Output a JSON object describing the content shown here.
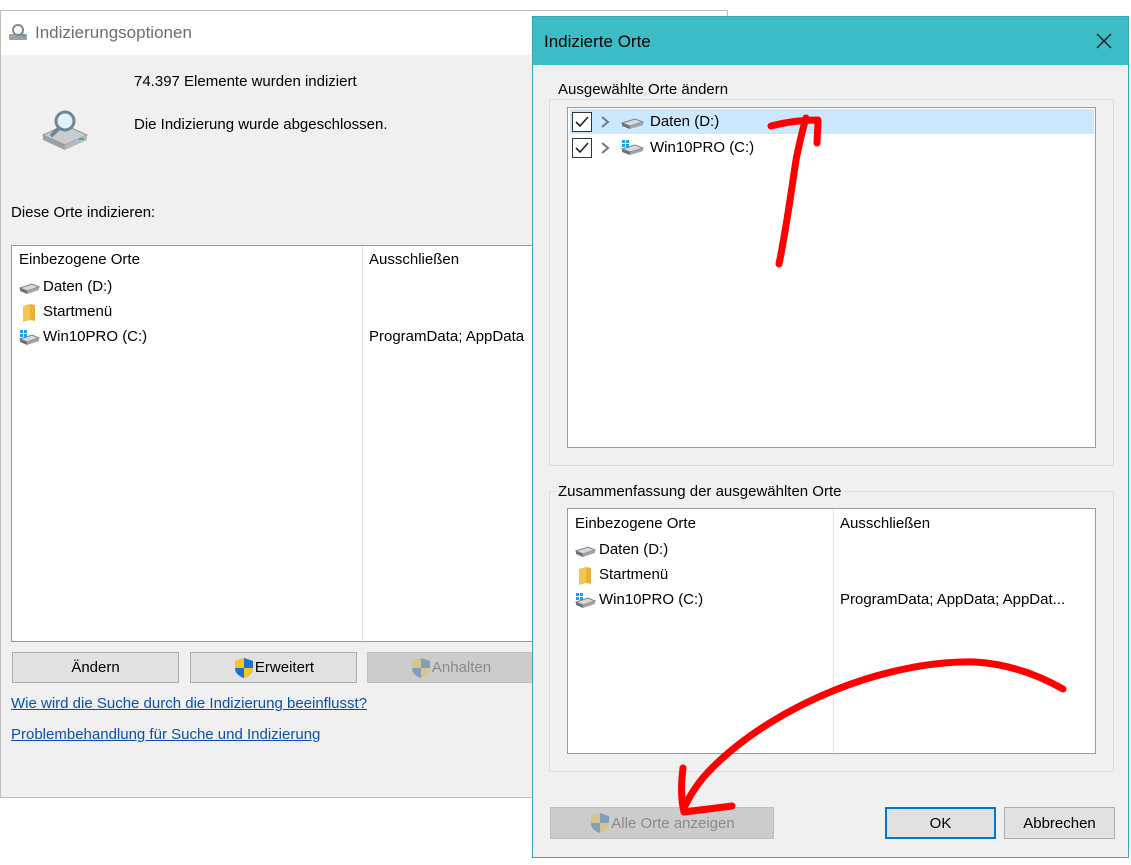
{
  "back_window": {
    "title": "Indizierungsoptionen",
    "status_count": "74.397 Elemente wurden indiziert",
    "status_message": "Die Indizierung wurde abgeschlossen.",
    "section_label": "Diese Orte indizieren:",
    "table": {
      "col_included": "Einbezogene Orte",
      "col_exclude": "Ausschließen",
      "rows": [
        {
          "name": "Daten (D:)",
          "icon": "drive-icon",
          "exclude": ""
        },
        {
          "name": "Startmenü",
          "icon": "folder-icon",
          "exclude": ""
        },
        {
          "name": "Win10PRO (C:)",
          "icon": "windows-drive-icon",
          "exclude": "ProgramData; AppData"
        }
      ]
    },
    "buttons": {
      "change": "Ändern",
      "advanced": "Erweitert",
      "pause": "Anhalten"
    },
    "links": {
      "how_affects": "Wie wird die Suche durch die Indizierung beeinflusst?",
      "troubleshoot": "Problembehandlung für Suche und Indizierung"
    }
  },
  "dialog": {
    "title": "Indizierte Orte",
    "close_icon": "close-icon",
    "group_change": {
      "label": "Ausgewählte Orte ändern",
      "items": [
        {
          "name": "Daten (D:)",
          "checked": true,
          "selected": true,
          "icon": "drive-icon"
        },
        {
          "name": "Win10PRO (C:)",
          "checked": true,
          "selected": false,
          "icon": "windows-drive-icon"
        }
      ]
    },
    "group_summary": {
      "label": "Zusammenfassung der ausgewählten Orte",
      "col_included": "Einbezogene Orte",
      "col_exclude": "Ausschließen",
      "rows": [
        {
          "name": "Daten (D:)",
          "icon": "drive-icon",
          "exclude": ""
        },
        {
          "name": "Startmenü",
          "icon": "folder-icon",
          "exclude": ""
        },
        {
          "name": "Win10PRO (C:)",
          "icon": "windows-drive-icon",
          "exclude": "ProgramData; AppData; AppDat..."
        }
      ]
    },
    "buttons": {
      "show_all": "Alle Orte anzeigen",
      "ok": "OK",
      "cancel": "Abbrechen"
    }
  },
  "annotation_color": "#ff0000"
}
